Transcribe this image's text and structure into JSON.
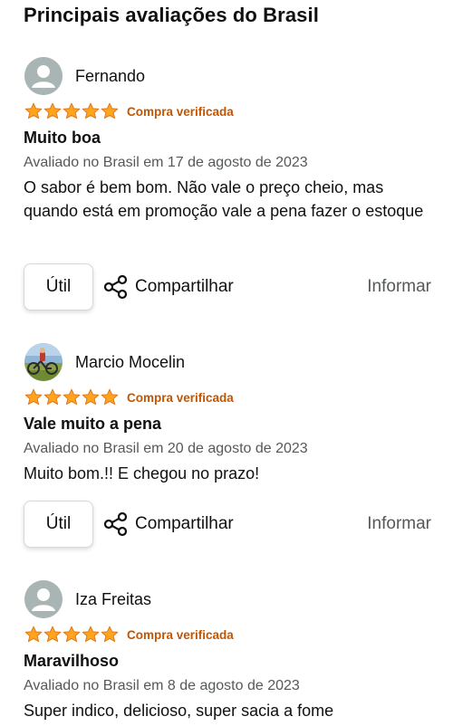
{
  "page": {
    "title": "Principais avaliações do Brasil"
  },
  "colors": {
    "star": "#ffa41c",
    "verified": "#c45500",
    "muted": "#565959"
  },
  "reviews": [
    {
      "author": "Fernando",
      "avatar": "default-avatar-icon",
      "rating": 5,
      "verified_label": "Compra verificada",
      "title": "Muito boa",
      "date": "Avaliado no Brasil em 17 de agosto de 2023",
      "body": "O sabor é bem bom. Não vale o preço cheio, mas quando está em promoção vale a pena fazer o estoque",
      "helpful_label": "Útil",
      "share_label": "Compartilhar",
      "report_label": "Informar"
    },
    {
      "author": "Marcio Mocelin",
      "avatar": "photo-avatar",
      "rating": 5,
      "verified_label": "Compra verificada",
      "title": "Vale muito a pena",
      "date": "Avaliado no Brasil em 20 de agosto de 2023",
      "body": "Muito bom.!! E chegou no prazo!",
      "helpful_label": "Útil",
      "share_label": "Compartilhar",
      "report_label": "Informar"
    },
    {
      "author": "Iza Freitas",
      "avatar": "default-avatar-icon",
      "rating": 5,
      "verified_label": "Compra verificada",
      "title": "Maravilhoso",
      "date": "Avaliado no Brasil em 8 de agosto de 2023",
      "body": "Super indico, delicioso, super sacia a fome"
    }
  ]
}
